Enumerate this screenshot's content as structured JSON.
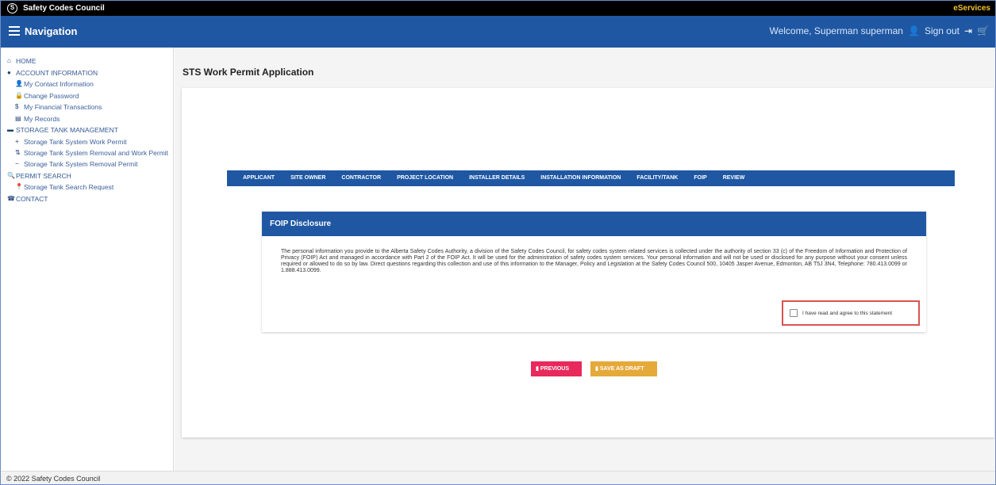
{
  "topbar": {
    "logo_glyph": "S",
    "brand": "Safety Codes Council",
    "eservices": "eServices"
  },
  "navbar": {
    "title": "Navigation",
    "welcome": "Welcome, Superman superman",
    "signout": "Sign out"
  },
  "sidebar": {
    "items": [
      {
        "label": "HOME",
        "icon": "home-icon",
        "glyph": "⌂",
        "level": 0
      },
      {
        "label": "ACCOUNT INFORMATION",
        "icon": "info-icon",
        "glyph": "●",
        "level": 0
      },
      {
        "label": "My Contact Information",
        "icon": "user-icon",
        "glyph": "👤",
        "level": 1
      },
      {
        "label": "Change Password",
        "icon": "lock-icon",
        "glyph": "🔒",
        "level": 1
      },
      {
        "label": "My Financial Transactions",
        "icon": "dollar-icon",
        "glyph": "$",
        "level": 1
      },
      {
        "label": "My Records",
        "icon": "file-icon",
        "glyph": "▤",
        "level": 1
      },
      {
        "label": "STORAGE TANK MANAGEMENT",
        "icon": "truck-icon",
        "glyph": "▬",
        "level": 0
      },
      {
        "label": "Storage Tank System Work Permit",
        "icon": "plus-square-icon",
        "glyph": "+",
        "level": 1
      },
      {
        "label": "Storage Tank System Removal and Work Permit",
        "icon": "exchange-icon",
        "glyph": "⇅",
        "level": 1
      },
      {
        "label": "Storage Tank System Removal Permit",
        "icon": "minus-circle-icon",
        "glyph": "−",
        "level": 1
      },
      {
        "label": "PERMIT SEARCH",
        "icon": "search-icon",
        "glyph": "🔍",
        "level": 0
      },
      {
        "label": "Storage Tank Search Request",
        "icon": "map-marker-icon",
        "glyph": "📍",
        "level": 1
      },
      {
        "label": "CONTACT",
        "icon": "phone-icon",
        "glyph": "☎",
        "level": 0
      }
    ]
  },
  "main": {
    "page_title": "STS Work Permit Application",
    "tabs": [
      "APPLICANT",
      "SITE OWNER",
      "CONTRACTOR",
      "PROJECT LOCATION",
      "INSTALLER DETAILS",
      "INSTALLATION INFORMATION",
      "FACILITY/TANK",
      "FOIP",
      "REVIEW"
    ],
    "active_tab": "FOIP",
    "foip": {
      "title": "FOIP Disclosure",
      "text": "The personal information you provide to the Alberta Safety Codes Authority, a division of the Safety Codes Council, for safety codes system related services is collected under the authority of section 33 (c) of the Freedom of Information and Protection of Privacy (FOIP) Act and managed in accordance with Part 2 of the FOIP Act. It will be used for the administration of safety codes system services. Your personal information and will not be used or disclosed for any purpose without your consent unless required or allowed to do so by law. Direct questions regarding this collection and use of this information to the Manager, Policy and Legislation at the Safety Codes Council 500, 10405 Jasper Avenue, Edmonton, AB T5J 3N4, Telephone: 780.413.0099 or 1.888.413.0099.",
      "agree_label": "I have read and agree to this statement",
      "agree_checked": false
    },
    "buttons": {
      "previous": "PREVIOUS",
      "save_draft": "SAVE AS DRAFT"
    }
  },
  "footer": {
    "text": "© 2022 Safety Codes Council"
  },
  "colors": {
    "navbar": "#1f57a3",
    "eservices": "#f2c22e",
    "previous_button": "#e8295c",
    "draft_button": "#e5a93a",
    "highlight_border": "#d9534f"
  }
}
